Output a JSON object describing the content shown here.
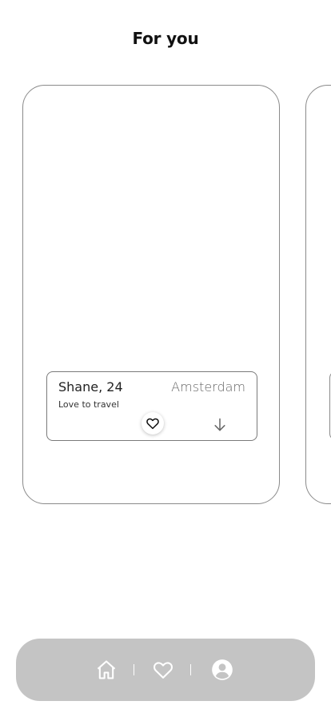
{
  "header": {
    "title": "For you"
  },
  "profile_card": {
    "name": "Shane, 24",
    "city": "Amsterdam",
    "bio": "Love to travel",
    "like_icon": "heart-outline-icon",
    "more_icon": "arrow-down-icon"
  },
  "bottom_nav": {
    "items": [
      {
        "icon": "home-icon"
      },
      {
        "icon": "heart-icon"
      },
      {
        "icon": "user-circle-icon"
      }
    ]
  },
  "colors": {
    "background": "#ffffff",
    "card_border": "#8a8a8a",
    "nav_background": "#c4c4c4",
    "nav_icon": "#ffffff",
    "text_primary": "#222222",
    "text_secondary": "#666666"
  }
}
